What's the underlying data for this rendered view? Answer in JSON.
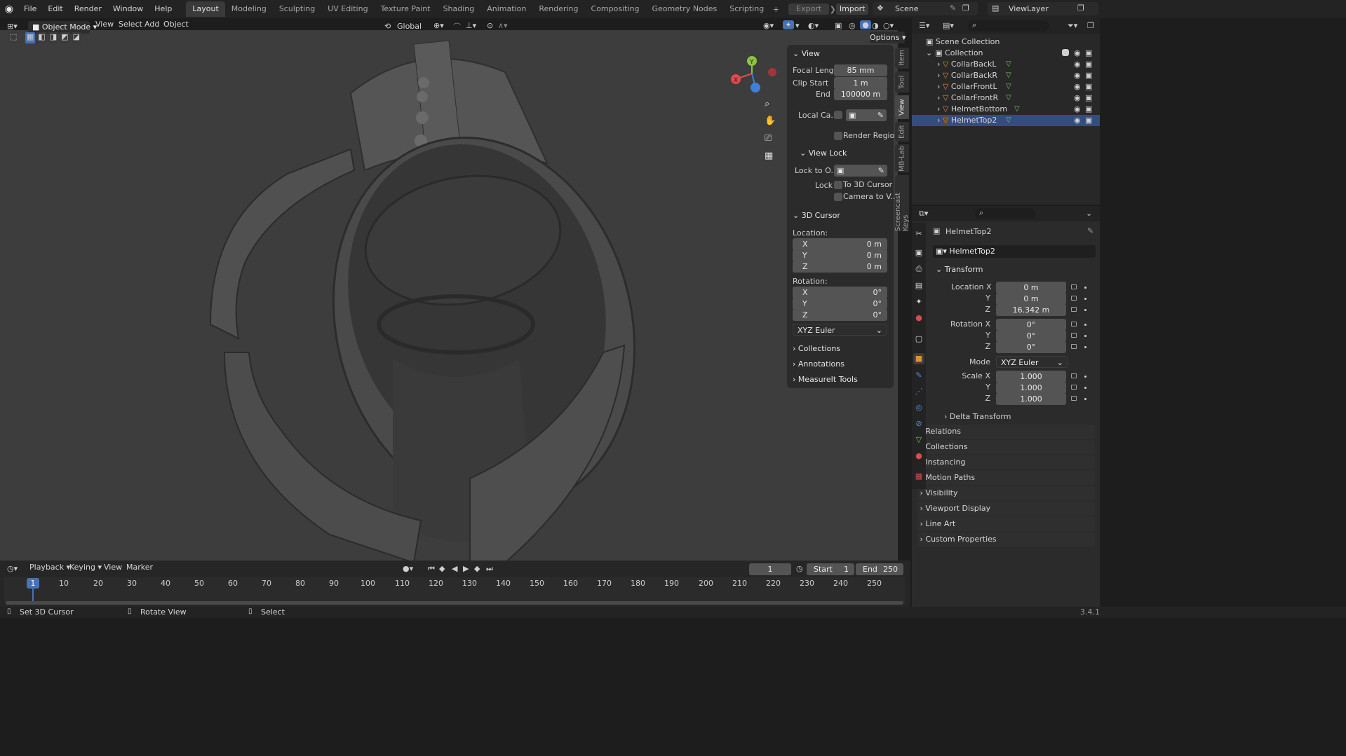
{
  "app": {
    "version": "3.4.1"
  },
  "menu": [
    "File",
    "Edit",
    "Render",
    "Window",
    "Help"
  ],
  "workspaces": [
    "Layout",
    "Modeling",
    "Sculpting",
    "UV Editing",
    "Texture Paint",
    "Shading",
    "Animation",
    "Rendering",
    "Compositing",
    "Geometry Nodes",
    "Scripting"
  ],
  "active_workspace": "Layout",
  "topbar": {
    "export_label": "Export",
    "import_label": "Import",
    "scene": "Scene",
    "view_layer": "ViewLayer"
  },
  "viewport_header": {
    "mode": "Object Mode",
    "menus": [
      "View",
      "Select",
      "Add",
      "Object"
    ],
    "orientation": "Global",
    "options_label": "Options"
  },
  "npanel": {
    "tabs": [
      "Item",
      "Tool",
      "View",
      "Edit",
      "MB-Lab",
      "Screencast Keys"
    ],
    "active_tab": "View",
    "view_header": "View",
    "focal_length_label": "Focal Length",
    "focal_length": "85 mm",
    "clip_start_label": "Clip Start",
    "clip_start": "1 m",
    "end_label": "End",
    "clip_end": "100000 m",
    "local_camera_label": "Local Ca...",
    "render_region_label": "Render Region",
    "view_lock_header": "View Lock",
    "lock_to_object_label": "Lock to O...",
    "lock_label": "Lock",
    "to_3d_cursor_label": "To 3D Cursor",
    "camera_to_view_label": "Camera to V...",
    "cursor_header": "3D Cursor",
    "location_label": "Location:",
    "rotation_label": "Rotation:",
    "axes": [
      "X",
      "Y",
      "Z"
    ],
    "location": [
      "0 m",
      "0 m",
      "0 m"
    ],
    "rotation": [
      "0°",
      "0°",
      "0°"
    ],
    "rotation_mode": "XYZ Euler",
    "collapsed": [
      "Collections",
      "Annotations",
      "MeasureIt Tools"
    ]
  },
  "outliner": {
    "scene_collection": "Scene Collection",
    "collection": "Collection",
    "objects": [
      "CollarBackL",
      "CollarBackR",
      "CollarFrontL",
      "CollarFrontR",
      "HelmetBottom",
      "HelmetTop2"
    ],
    "selected": "HelmetTop2"
  },
  "properties": {
    "object_name": "HelmetTop2",
    "data_name": "HelmetTop2",
    "transform_header": "Transform",
    "location_x_label": "Location X",
    "location": [
      "0 m",
      "0 m",
      "16.342 m"
    ],
    "rotation_x_label": "Rotation X",
    "rotation": [
      "0°",
      "0°",
      "0°"
    ],
    "mode_label": "Mode",
    "mode": "XYZ Euler",
    "scale_x_label": "Scale X",
    "scale": [
      "1.000",
      "1.000",
      "1.000"
    ],
    "y_label": "Y",
    "z_label": "Z",
    "delta_transform": "Delta Transform",
    "sections": [
      "Relations",
      "Collections",
      "Instancing",
      "Motion Paths",
      "Visibility",
      "Viewport Display",
      "Line Art",
      "Custom Properties"
    ]
  },
  "timeline": {
    "menus": [
      "Playback",
      "Keying",
      "View",
      "Marker"
    ],
    "current_frame": "1",
    "start_label": "Start",
    "start": "1",
    "end_label": "End",
    "end": "250",
    "ticks": [
      "10",
      "20",
      "30",
      "40",
      "50",
      "60",
      "70",
      "80",
      "90",
      "100",
      "110",
      "120",
      "130",
      "140",
      "150",
      "160",
      "170",
      "180",
      "190",
      "200",
      "210",
      "220",
      "230",
      "240",
      "250"
    ],
    "playhead": "1"
  },
  "status": {
    "left": "Set 3D Cursor",
    "middle": "Rotate View",
    "right": "Select"
  },
  "colors": {
    "accent": "#4772b3",
    "selected_row": "#334d80",
    "axis_x": "#e5484d",
    "axis_y": "#8bc540",
    "axis_z": "#3d7fd9",
    "mesh_icon": "#d08b3a",
    "vertex_icon": "#6ecb56"
  }
}
